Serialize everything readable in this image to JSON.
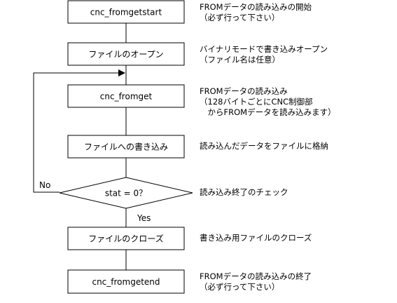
{
  "flowchart": {
    "steps": {
      "start": "cnc_fromgetstart",
      "open": "ファイルのオープン",
      "get": "cnc_fromget",
      "write": "ファイルへの書き込み",
      "check": "stat = 0？",
      "close": "ファイルのクローズ",
      "end": "cnc_fromgetend"
    },
    "edges": {
      "no": "No",
      "yes": "Yes"
    },
    "notes": {
      "start": [
        "FROMデータの読み込みの開始",
        "（必ず行って下さい）"
      ],
      "open": [
        "バイナリモードで書き込みオープン",
        "（ファイル名は任意）"
      ],
      "get": [
        "FROMデータの読み込み",
        "（128バイトごとにCNC制御部",
        "　からFROMデータを読み込みます）"
      ],
      "write": [
        "読み込んだデータをファイルに格納"
      ],
      "check": [
        "読み込み終了のチェック"
      ],
      "close": [
        "書き込み用ファイルのクローズ"
      ],
      "end": [
        "FROMデータの読み込みの終了",
        "（必ず行って下さい）"
      ]
    }
  }
}
